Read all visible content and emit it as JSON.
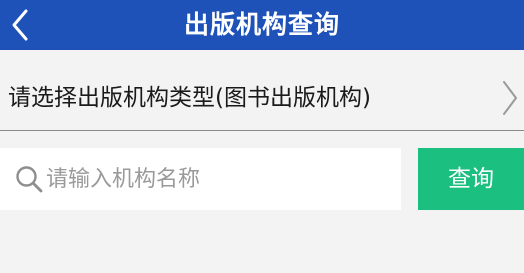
{
  "header": {
    "title": "出版机构查询",
    "back_icon": "chevron-left-icon",
    "background_color": "#1f52b8"
  },
  "type_selector": {
    "label": "请选择出版机构类型(图书出版机构)",
    "icon": "chevron-right-icon"
  },
  "search": {
    "placeholder": "请输入机构名称",
    "value": "",
    "icon": "search-icon"
  },
  "query_button": {
    "label": "查询",
    "background_color": "#1bbf7f"
  }
}
